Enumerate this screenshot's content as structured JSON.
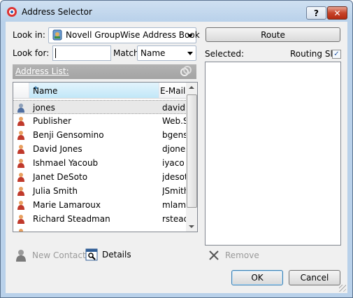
{
  "window": {
    "title": "Address Selector",
    "help_label": "?",
    "close_label": "✕"
  },
  "lookin": {
    "label": "Look in:",
    "value": "Novell GroupWise Address Book"
  },
  "lookfor": {
    "label": "Look for:",
    "value": "",
    "match_label": "Match",
    "match_value": "Name"
  },
  "address_list": {
    "label": "Address List:"
  },
  "columns": {
    "name": "Name",
    "email": "E-Mail"
  },
  "contacts": [
    {
      "name": "jones",
      "email": "david"
    },
    {
      "name": "Publisher",
      "email": "Web.S"
    },
    {
      "name": "Benji Gensomino",
      "email": "bgens"
    },
    {
      "name": "David Jones",
      "email": "djone"
    },
    {
      "name": "Ishmael Yacoub",
      "email": "iyaco"
    },
    {
      "name": "Janet DeSoto",
      "email": "jdesot"
    },
    {
      "name": "Julia Smith",
      "email": "JSmith"
    },
    {
      "name": "Marie Lamaroux",
      "email": "mlam"
    },
    {
      "name": "Richard Steadman",
      "email": "rstead"
    }
  ],
  "route_button": "Route",
  "selected_label": "Selected:",
  "routing_slip": {
    "label": "Routing Slip",
    "checked": true,
    "mark": "✓"
  },
  "toolbar": {
    "new_contact": "New Contact",
    "details": "Details",
    "remove": "Remove"
  },
  "buttons": {
    "ok": "OK",
    "cancel": "Cancel"
  }
}
